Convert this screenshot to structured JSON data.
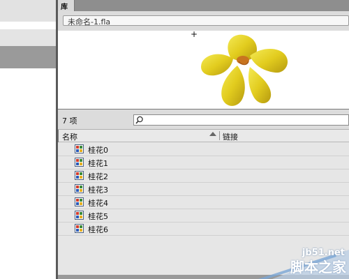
{
  "panel": {
    "tab_label": "库",
    "file_name": "未命名-1.fla",
    "item_count": "7 项",
    "search": {
      "placeholder": "",
      "value": ""
    },
    "columns": {
      "name": "名称",
      "linkage": "链接"
    },
    "items": [
      {
        "label": "桂花0",
        "type": "graphic"
      },
      {
        "label": "桂花1",
        "type": "graphic"
      },
      {
        "label": "桂花2",
        "type": "graphic"
      },
      {
        "label": "桂花3",
        "type": "graphic"
      },
      {
        "label": "桂花4",
        "type": "graphic"
      },
      {
        "label": "桂花5",
        "type": "graphic"
      },
      {
        "label": "桂花6",
        "type": "graphic"
      }
    ]
  },
  "preview": {
    "symbol": "yellow-flower",
    "colors": {
      "petal": "#e7d321",
      "center": "#c8741f"
    }
  },
  "watermark": {
    "site": "jb51.net",
    "name": "脚本之家"
  }
}
